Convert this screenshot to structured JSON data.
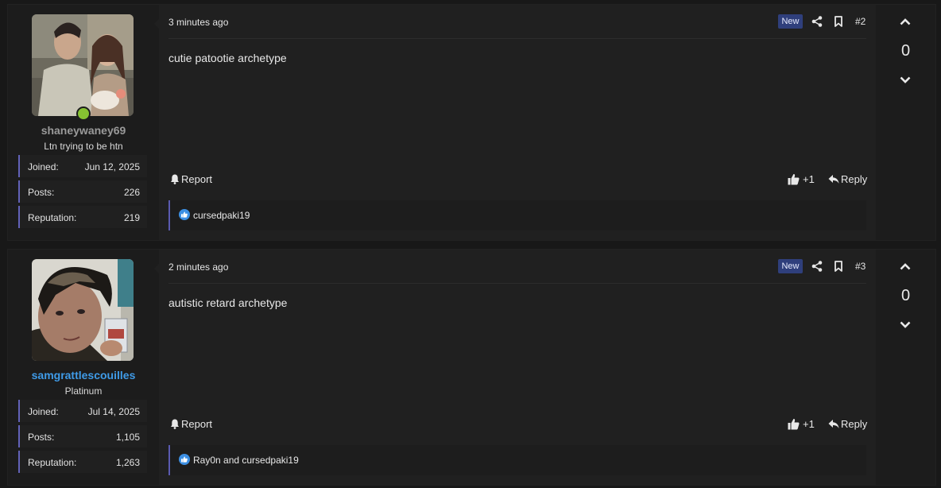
{
  "posts": [
    {
      "time": "3 minutes ago",
      "badge": "New",
      "post_number": "#2",
      "body": "cutie patootie archetype",
      "report_label": "Report",
      "like_label": "+1",
      "reply_label": "Reply",
      "reactions_text": "cursedpaki19",
      "vote_count": "0",
      "user": {
        "username": "shaneywaney69",
        "title": "Ltn trying to be htn",
        "online": true,
        "stats": [
          {
            "label": "Joined:",
            "value": "Jun 12, 2025"
          },
          {
            "label": "Posts:",
            "value": "226"
          },
          {
            "label": "Reputation:",
            "value": "219"
          }
        ]
      }
    },
    {
      "time": "2 minutes ago",
      "badge": "New",
      "post_number": "#3",
      "body": "autistic retard archetype",
      "report_label": "Report",
      "like_label": "+1",
      "reply_label": "Reply",
      "reactions_text": "Ray0n and cursedpaki19",
      "vote_count": "0",
      "user": {
        "username": "samgrattlescouilles",
        "title": "Platinum",
        "online": false,
        "stats": [
          {
            "label": "Joined:",
            "value": "Jul 14, 2025"
          },
          {
            "label": "Posts:",
            "value": "1,105"
          },
          {
            "label": "Reputation:",
            "value": "1,263"
          }
        ]
      }
    }
  ],
  "colors": {
    "online": "#86c232",
    "username_gray": "#9a9a9a",
    "username_blue": "#3f9be8",
    "badge_bg": "#2f3f7c",
    "stat_accent": "#6262b8"
  }
}
